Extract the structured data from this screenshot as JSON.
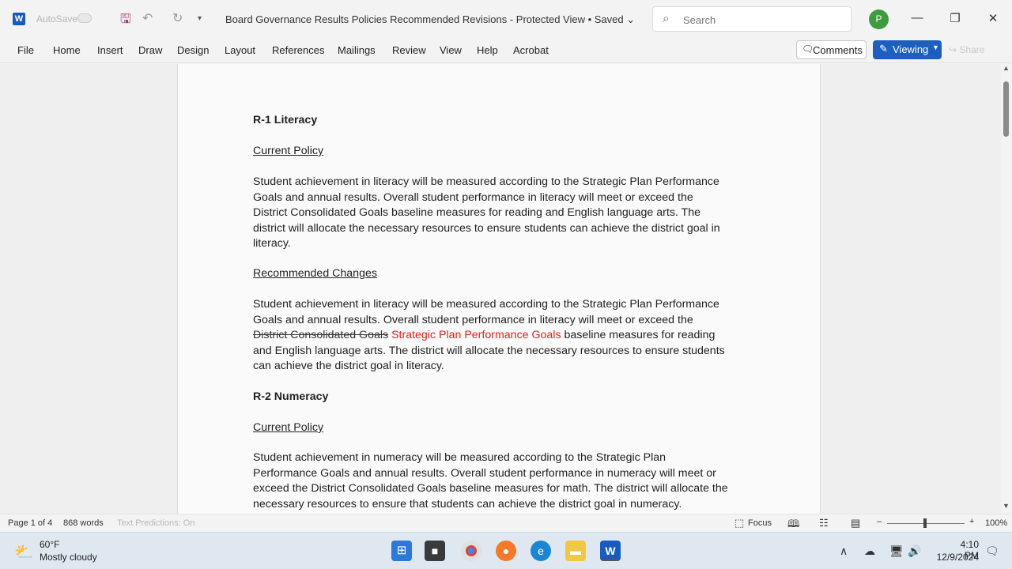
{
  "titlebar": {
    "autosave_label": "AutoSave",
    "document_title": "Board Governance Results Policies Recommended Revisions  -  Protected View • Saved ⌄",
    "search_placeholder": "Search",
    "avatar_initial": "P"
  },
  "ribbon": {
    "tabs": [
      "File",
      "Home",
      "Insert",
      "Draw",
      "Design",
      "Layout",
      "References",
      "Mailings",
      "Review",
      "View",
      "Help",
      "Acrobat"
    ],
    "comments_label": "Comments",
    "viewing_label": "Viewing",
    "share_label": "Share"
  },
  "document": {
    "r1_heading": "R-1 Literacy",
    "r1_current_label": "Current Policy",
    "r1_current_lines": [
      "Student achievement in literacy will be measured according to the Strategic Plan Performance",
      "Goals and annual results. Overall student performance in literacy will meet or exceed the",
      "District Consolidated Goals baseline measures for reading and English language arts. The",
      "district will allocate the necessary resources to ensure students can achieve the district goal in",
      "literacy."
    ],
    "r1_changes_label": "Recommended Changes",
    "r1_changes_line1": "Student achievement in literacy will be measured according to the Strategic Plan Performance",
    "r1_changes_line2": "Goals and annual results. Overall student performance in literacy will meet or exceed the",
    "r1_changes_deleted": "District Consolidated Goals",
    "r1_changes_inserted": "Strategic Plan Performance Goals",
    "r1_changes_line3_rest": " baseline measures for reading",
    "r1_changes_line4": "and English language arts. The district will allocate the necessary resources to ensure students",
    "r1_changes_line5": "can achieve the district goal in literacy.",
    "r2_heading": "R-2 Numeracy",
    "r2_current_label": "Current Policy",
    "r2_current_lines": [
      "Student achievement in numeracy will be measured according to the Strategic Plan",
      "Performance Goals and annual results. Overall student performance in numeracy will meet or",
      "exceed the District Consolidated Goals baseline measures for math. The district will allocate the",
      "necessary resources to ensure that students can achieve the district goal in numeracy."
    ]
  },
  "statusbar": {
    "page": "Page 1 of 4",
    "words": "868 words",
    "text_predictions": "Text Predictions: On",
    "focus": "Focus",
    "zoom": "100%"
  },
  "taskbar": {
    "temperature": "60°F",
    "weather": "Mostly cloudy",
    "time": "4:10 PM",
    "date": "12/9/2024"
  }
}
